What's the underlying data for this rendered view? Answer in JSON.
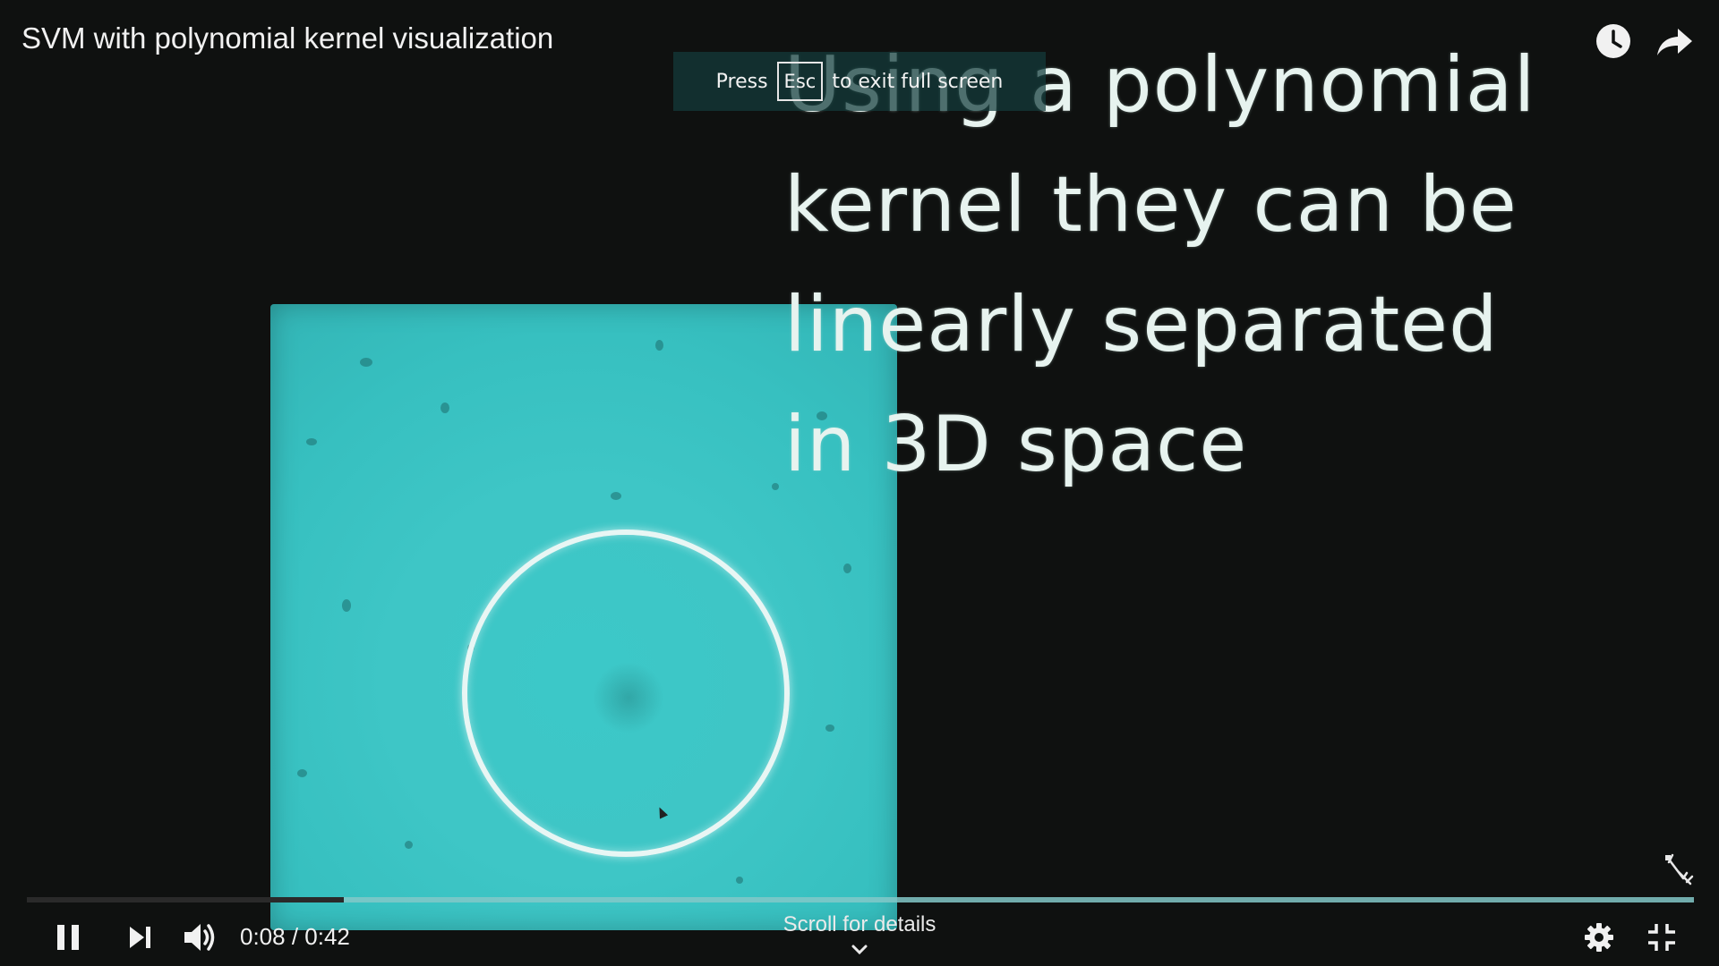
{
  "video": {
    "title": "SVM with polynomial kernel visualization",
    "caption_lines": [
      "Using a polynomial",
      "kernel they can be",
      "linearly separated",
      "in 3D space"
    ]
  },
  "fullscreen_toast": {
    "press": "Press",
    "key": "Esc",
    "message": "to exit full screen"
  },
  "controls": {
    "time_display": "0:08 / 0:42",
    "scroll_hint": "Scroll for details",
    "progress_fraction": 0.19,
    "icons": {
      "play_pause": "pause-icon",
      "next": "next-icon",
      "volume": "volume-icon",
      "settings": "gear-icon",
      "exit_fullscreen": "exit-fullscreen-icon",
      "watch_later": "clock-icon",
      "share": "share-arrow-icon",
      "annotation": "annotation-icon"
    }
  },
  "colors": {
    "frame_fill": "#3ec6c6",
    "boundary_circle": "#e8f6f4",
    "caption_text": "#e7f3ef",
    "progress_track": "#82c8c8"
  }
}
